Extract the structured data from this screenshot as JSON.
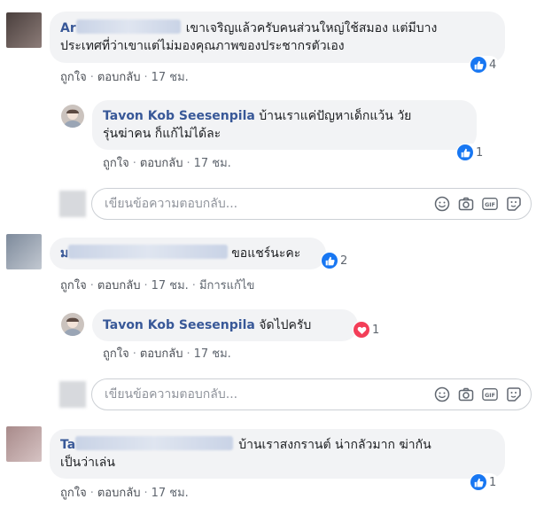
{
  "comments": [
    {
      "name_visible": "Ar",
      "text_line1": "เขาเจริญแล้วครับคนส่วนใหญ่ใช้สมอง แต่มีบาง",
      "text_line2": "ประเทศที่ว่าเขาแต่ไม่มองคุณภาพของประชากรตัวเอง",
      "actions": {
        "like": "ถูกใจ",
        "reply": "ตอบกลับ",
        "time": "17 ชม."
      },
      "reaction_count": "4"
    },
    {
      "name": "Tavon Kob Seesenpila",
      "text_line1": "บ้านเราแค่ปัญหาเด็กแว้น วัย",
      "text_line2": "รุ่นฆ่าคน ก็แก้ไม่ได้ละ",
      "actions": {
        "like": "ถูกใจ",
        "reply": "ตอบกลับ",
        "time": "17 ชม."
      },
      "reaction_count": "1"
    },
    {
      "name_visible": "ม",
      "text": "ขอแชร์นะคะ",
      "actions": {
        "like": "ถูกใจ",
        "reply": "ตอบกลับ",
        "time": "17 ชม.",
        "edited": "มีการแก้ไข"
      },
      "reaction_count": "2"
    },
    {
      "name": "Tavon Kob Seesenpila",
      "text": "จัดไปครับ",
      "actions": {
        "like": "ถูกใจ",
        "reply": "ตอบกลับ",
        "time": "17 ชม."
      },
      "reaction_count": "1"
    },
    {
      "name_visible": "Ta",
      "text_line1": "บ้านเราสงกรานต์ น่ากลัวมาก ฆ่ากัน",
      "text_line2": "เป็นว่าเล่น",
      "actions": {
        "like": "ถูกใจ",
        "reply": "ตอบกลับ",
        "time": "17 ชม."
      },
      "reaction_count": "1"
    }
  ],
  "reply_box": {
    "placeholder": "เขียนข้อความตอบกลับ...",
    "gif_label": "GIF"
  },
  "icons": [
    "emoji-icon",
    "camera-icon",
    "gif-icon",
    "sticker-icon",
    "like-icon",
    "love-icon"
  ],
  "colors": {
    "name": "#385898",
    "bubble": "#f2f3f5",
    "like": "#1877f2",
    "love": "#f33e58"
  }
}
